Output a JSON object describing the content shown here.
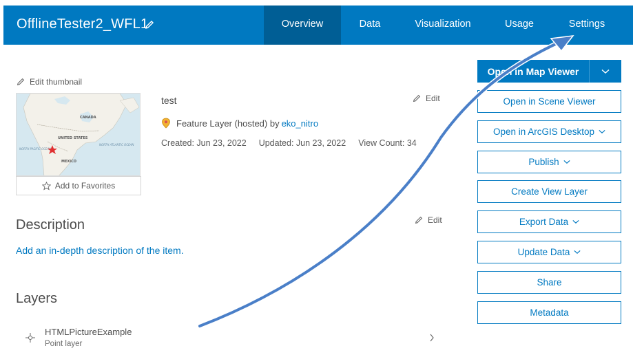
{
  "header": {
    "title": "OfflineTester2_WFL1",
    "tabs": [
      {
        "label": "Overview",
        "active": true
      },
      {
        "label": "Data",
        "active": false
      },
      {
        "label": "Visualization",
        "active": false
      },
      {
        "label": "Usage",
        "active": false
      },
      {
        "label": "Settings",
        "active": false
      }
    ]
  },
  "thumbnail": {
    "edit_label": "Edit thumbnail",
    "favorites_label": "Add to Favorites",
    "map_labels": [
      "CANADA",
      "UNITED STATES",
      "NORTH PACIFIC OCEAN",
      "NORTH ATLANTIC OCEAN",
      "MEXICO"
    ]
  },
  "summary": {
    "text": "test",
    "edit_label": "Edit",
    "type_text": "Feature Layer (hosted) by",
    "owner": "eko_nitro",
    "created": "Created: Jun 23, 2022",
    "updated": "Updated: Jun 23, 2022",
    "views": "View Count: 34"
  },
  "description": {
    "heading": "Description",
    "edit_label": "Edit",
    "add_link": "Add an in-depth description of the item."
  },
  "layers": {
    "heading": "Layers",
    "items": [
      {
        "name": "HTMLPictureExample",
        "type": "Point layer"
      }
    ]
  },
  "actions": {
    "primary": "Open in Map Viewer",
    "scene": "Open in Scene Viewer",
    "desktop": "Open in ArcGIS Desktop",
    "publish": "Publish",
    "create_view": "Create View Layer",
    "export": "Export Data",
    "update": "Update Data",
    "share": "Share",
    "metadata": "Metadata"
  },
  "colors": {
    "brand": "#0079c1",
    "brand_dark": "#005e95",
    "annotation_arrow": "#4a7fc8"
  }
}
